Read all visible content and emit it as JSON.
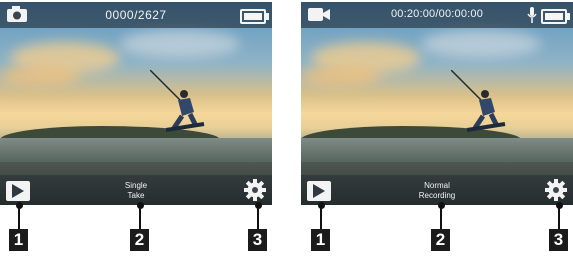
{
  "panels": [
    {
      "mode_icon": "camera-icon",
      "counter": "0000/2627",
      "bottom_label_line1": "Single",
      "bottom_label_line2": "Take",
      "left_button_icon": "play-icon",
      "right_button_icon": "gear-icon",
      "battery_icon": "battery-icon"
    },
    {
      "mode_icon": "video-camera-icon",
      "counter": "00:20:00/00:00:00",
      "bottom_label_line1": "Normal",
      "bottom_label_line2": "Recording",
      "left_button_icon": "play-icon",
      "right_button_icon": "gear-icon",
      "mic_icon": "microphone-icon",
      "battery_icon": "battery-icon"
    }
  ],
  "callouts": [
    "1",
    "2",
    "3",
    "1",
    "2",
    "3"
  ],
  "colors": {
    "overlay_bar": "#141c24",
    "callout_box": "#1b1b1b",
    "icon": "#f3f3f3"
  }
}
